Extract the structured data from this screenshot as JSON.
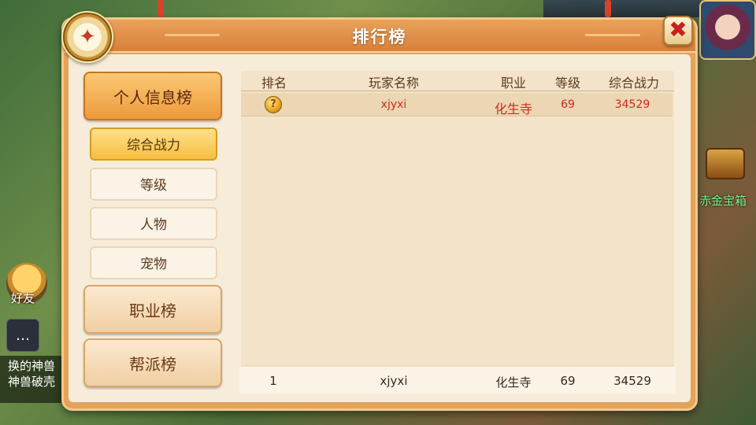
{
  "panel": {
    "title": "排行榜",
    "close_icon_glyph": "✖",
    "medal_icon": "ranking-medal-icon"
  },
  "categories": [
    {
      "label": "个人信息榜",
      "active": true
    },
    {
      "label": "职业榜",
      "active": false
    },
    {
      "label": "帮派榜",
      "active": false
    }
  ],
  "subcategories": [
    {
      "label": "综合战力",
      "active": true
    },
    {
      "label": "等级",
      "active": false
    },
    {
      "label": "人物",
      "active": false
    },
    {
      "label": "宠物",
      "active": false
    }
  ],
  "table": {
    "headers": [
      "排名",
      "玩家名称",
      "职业",
      "等级",
      "综合战力"
    ],
    "rows": [
      {
        "rank_icon": "gold-rank-medal-icon",
        "name": "xjyxi",
        "job": "化生寺",
        "level": "69",
        "power": "34529"
      }
    ],
    "self_row": {
      "rank": "1",
      "name": "xjyxi",
      "job": "化生寺",
      "level": "69",
      "power": "34529"
    }
  },
  "background": {
    "friend_label": "好友",
    "chat_lines": [
      "换的神兽",
      "神兽破壳"
    ],
    "chest_label": "赤金宝箱"
  }
}
